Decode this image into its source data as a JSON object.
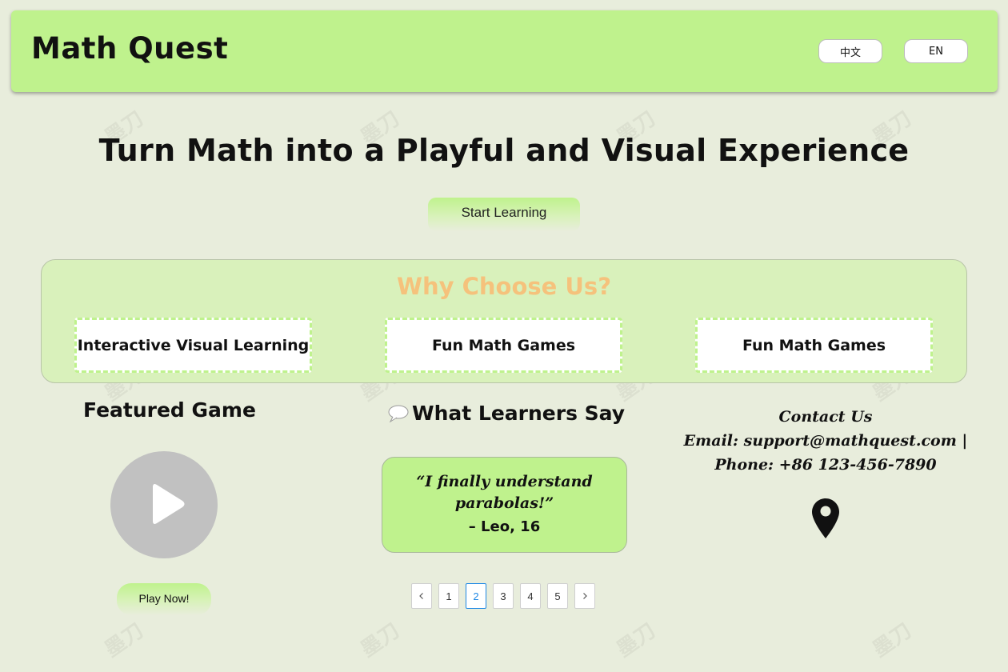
{
  "header": {
    "brand": "Math Quest",
    "lang_zh": "中文",
    "lang_en": "EN"
  },
  "hero": {
    "title": "Turn Math into a Playful and Visual Experience",
    "cta": "Start Learning"
  },
  "why": {
    "title": "Why Choose Us?",
    "features": [
      "Interactive Visual Learning",
      "Fun Math Games",
      "Fun Math Games"
    ]
  },
  "featured": {
    "title": "Featured Game",
    "play_label": "Play Now!"
  },
  "testimonials": {
    "title": "What Learners Say",
    "quote": "“I finally understand parabolas!”",
    "author": "– Leo, 16",
    "pages": [
      "1",
      "2",
      "3",
      "4",
      "5"
    ],
    "current_page": "2"
  },
  "contact": {
    "title": "Contact Us",
    "email_line": "Email: support@mathquest.com |",
    "phone_line": "Phone: +86 123-456-7890"
  },
  "watermark": "墨刀",
  "colors": {
    "accent_green": "#bff28d",
    "why_title_orange": "#f5c27c",
    "page_bg": "#e8eddc",
    "active_page_blue": "#1e88e5"
  },
  "icons": [
    "speech-bubble-icon",
    "play-icon",
    "map-pin-icon",
    "chevron-left-icon",
    "chevron-right-icon"
  ]
}
